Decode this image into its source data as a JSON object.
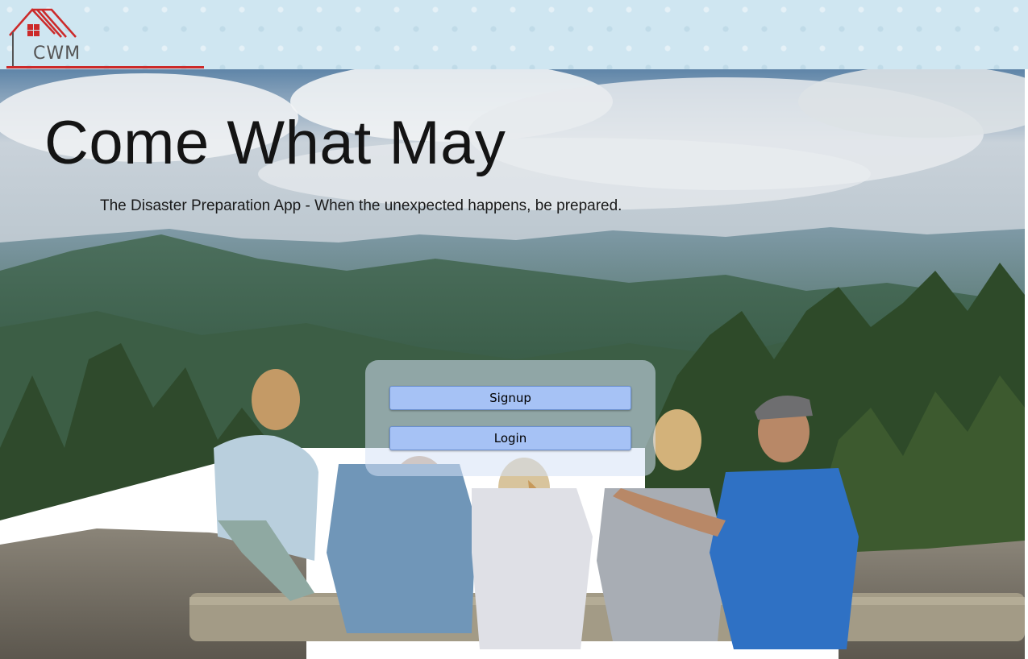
{
  "header": {
    "logo_text": "CWM"
  },
  "hero": {
    "title": "Come What May",
    "subtitle": "The Disaster Preparation App - When the unexpected happens, be prepared."
  },
  "auth": {
    "signup_label": "Signup",
    "login_label": "Login"
  },
  "colors": {
    "brand_red": "#cc2a2a",
    "header_bg": "#cfe6f1",
    "button_bg": "#a6c2f5"
  },
  "icons": {
    "logo": "house-logo-icon"
  }
}
